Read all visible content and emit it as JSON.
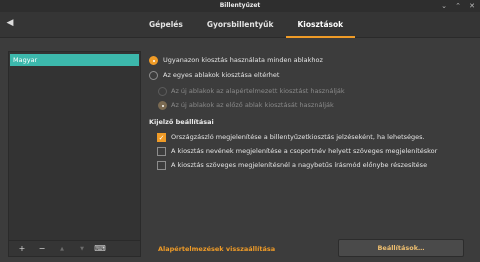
{
  "window": {
    "title": "Billentyűzet"
  },
  "titlebar": {
    "minimize_icon": "minimize-icon",
    "maximize_icon": "maximize-icon",
    "close_icon": "close-icon"
  },
  "header": {
    "back_icon": "back-arrow-icon",
    "tabs": [
      {
        "label": "Gépelés",
        "active": false
      },
      {
        "label": "Gyorsbillentyűk",
        "active": false
      },
      {
        "label": "Kiosztások",
        "active": true
      }
    ]
  },
  "sidebar": {
    "layouts": [
      {
        "label": "Magyar",
        "selected": true
      }
    ],
    "toolbar": [
      "add-icon",
      "remove-icon",
      "move-up-icon",
      "move-down-icon",
      "keyboard-icon"
    ]
  },
  "options": {
    "radio_same": "Ugyanazon kiosztás használata minden ablakhoz",
    "radio_separate": "Az egyes ablakok kiosztása eltérhet",
    "sub_default": "Az új ablakok az alapértelmezett kiosztást használják",
    "sub_previous": "Az új ablakok az előző ablak kiosztását használják"
  },
  "indicator": {
    "title": "Kijelző beállításai",
    "flag": "Országzászló megjelenítése a billentyűzetkiosztás jelzéseként, ha lehetséges.",
    "group_name": "A kiosztás nevének megjelenítése a csoportnév helyett szöveges megjelenítéskor",
    "uppercase": "A kiosztás szöveges megjelenítésnél a nagybetűs írásmód előnybe részesítése"
  },
  "buttons": {
    "reset": "Alapértelmezések visszaállítása",
    "settings": "Beállítások…"
  },
  "colors": {
    "accent": "#ef9b27",
    "selection": "#3cb8ac"
  }
}
